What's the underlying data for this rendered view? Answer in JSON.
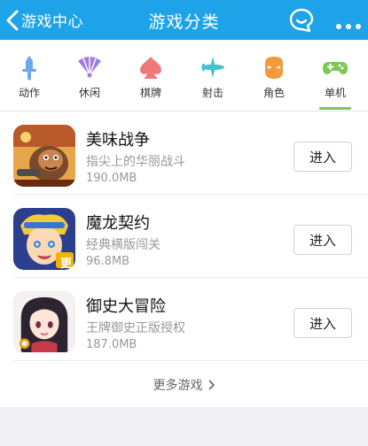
{
  "header": {
    "back_label": "游戏中心",
    "title": "游戏分类"
  },
  "tabs": [
    {
      "label": "动作",
      "icon": "sword-icon",
      "color": "#6aa7ee",
      "selected": false
    },
    {
      "label": "休闲",
      "icon": "fan-icon",
      "color": "#a37ce0",
      "selected": false
    },
    {
      "label": "棋牌",
      "icon": "spade-icon",
      "color": "#f07878",
      "selected": false
    },
    {
      "label": "射击",
      "icon": "plane-icon",
      "color": "#46c1cf",
      "selected": false
    },
    {
      "label": "角色",
      "icon": "mask-icon",
      "color": "#f49a3b",
      "selected": false
    },
    {
      "label": "单机",
      "icon": "gamepad-icon",
      "color": "#7dc856",
      "selected": true
    }
  ],
  "games": [
    {
      "name": "美味战争",
      "desc": "指尖上的华丽战斗",
      "size": "190.0MB",
      "button": "进入"
    },
    {
      "name": "魔龙契约",
      "desc": "经典横版闯关",
      "size": "96.8MB",
      "button": "进入",
      "badge": "更"
    },
    {
      "name": "御史大冒险",
      "desc": "王牌御史正版授权",
      "size": "187.0MB",
      "button": "进入"
    }
  ],
  "more_label": "更多游戏"
}
